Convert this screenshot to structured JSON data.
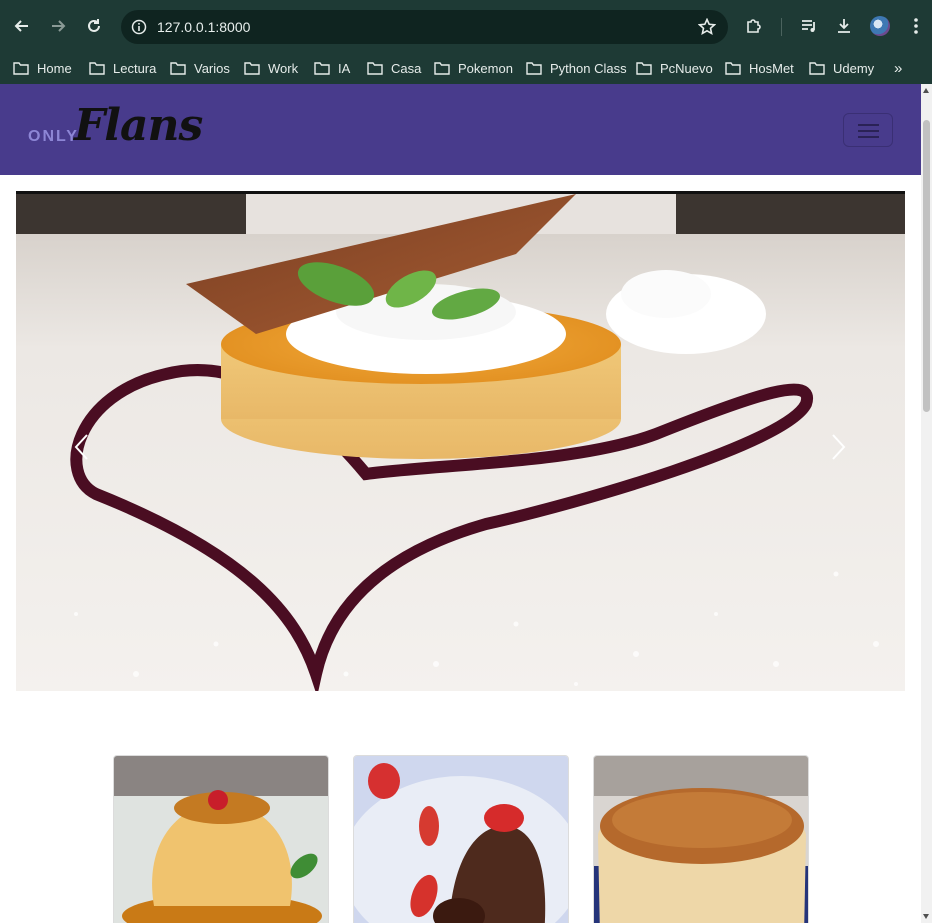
{
  "browser": {
    "url": "127.0.0.1:8000",
    "bookmarks": [
      {
        "label": "Home"
      },
      {
        "label": "Lectura"
      },
      {
        "label": "Varios"
      },
      {
        "label": "Work"
      },
      {
        "label": "IA"
      },
      {
        "label": "Casa"
      },
      {
        "label": "Pokemon"
      },
      {
        "label": "Python Class"
      },
      {
        "label": "PcNuevo"
      },
      {
        "label": "HosMet"
      },
      {
        "label": "Udemy"
      }
    ],
    "more_label": "»"
  },
  "site": {
    "brand_prefix": "ONLY",
    "brand_name": "Flans",
    "navbar_color": "#483b8c"
  },
  "carousel": {
    "image": "flan-with-whipped-cream-and-berry-sauce",
    "prev_icon": "chevron-left-icon",
    "next_icon": "chevron-right-icon"
  },
  "cards": [
    {
      "image": "caramel-flan-with-cherry"
    },
    {
      "image": "chocolate-lava-cake-with-strawberries"
    },
    {
      "image": "classic-caramel-flan"
    }
  ],
  "colors": {
    "chrome": "#1e3a35",
    "omnibox": "#0f2420",
    "accent": "#483b8c"
  }
}
